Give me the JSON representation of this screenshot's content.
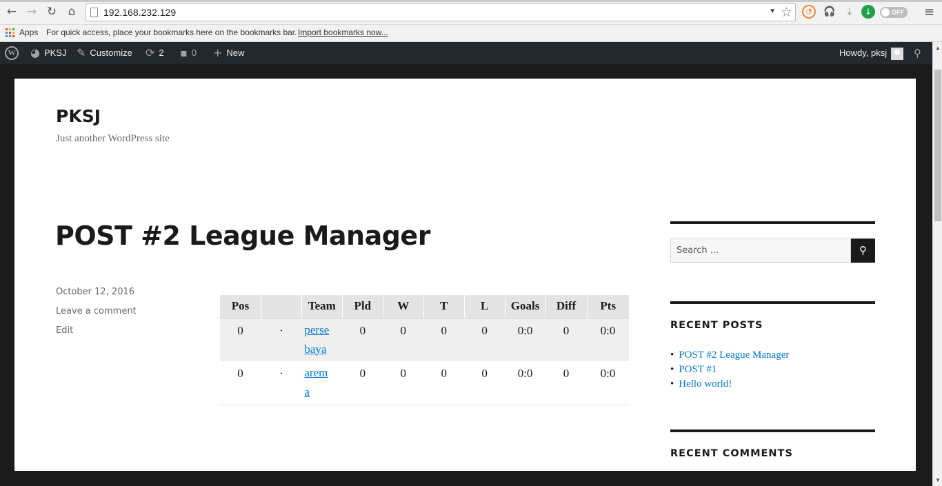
{
  "browser": {
    "url": "192.168.232.129",
    "bookmarks_apps": "Apps",
    "bookmarks_hint": "For quick access, place your bookmarks here on the bookmarks bar.",
    "bookmarks_import": "Import bookmarks now...",
    "ext_toggle_label": "OFF"
  },
  "adminbar": {
    "site_name": "PKSJ",
    "customize": "Customize",
    "updates_count": "2",
    "comments_count": "0",
    "new_label": "New",
    "howdy": "Howdy, pksj"
  },
  "site": {
    "title": "PKSJ",
    "description": "Just another WordPress site"
  },
  "post": {
    "title": "POST #2 League Manager",
    "date": "October 12, 2016",
    "comment_link": "Leave a comment",
    "edit_link": "Edit"
  },
  "league_table": {
    "headers": [
      "Pos",
      "",
      "Team",
      "Pld",
      "W",
      "T",
      "L",
      "Goals",
      "Diff",
      "Pts"
    ],
    "rows": [
      {
        "pos": "0",
        "marker": "·",
        "team_line1": "perse",
        "team_line2": "baya",
        "pld": "0",
        "w": "0",
        "t": "0",
        "l": "0",
        "goals": "0:0",
        "diff": "0",
        "pts": "0:0"
      },
      {
        "pos": "0",
        "marker": "·",
        "team_line1": "arem",
        "team_line2": "a",
        "pld": "0",
        "w": "0",
        "t": "0",
        "l": "0",
        "goals": "0:0",
        "diff": "0",
        "pts": "0:0"
      }
    ]
  },
  "sidebar": {
    "search_placeholder": "Search ...",
    "recent_posts_title": "RECENT POSTS",
    "recent_posts": [
      "POST #2 League Manager",
      "POST #1",
      "Hello world!"
    ],
    "recent_comments_title": "RECENT COMMENTS"
  },
  "colors": {
    "link": "#007acc",
    "adminbar": "#23282d",
    "text": "#1a1a1a"
  }
}
